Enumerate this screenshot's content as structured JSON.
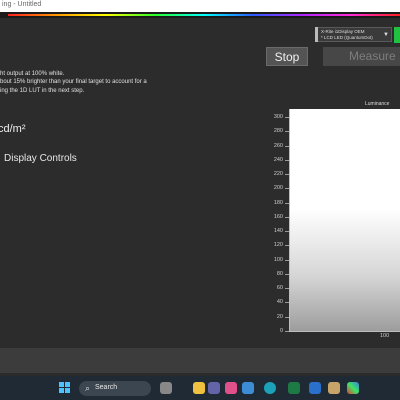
{
  "window": {
    "title": "ing - Untitled"
  },
  "device": {
    "line1": "X-Rite i1Display OEM",
    "line2": "* LCD LED (QuantumDot)"
  },
  "buttons": {
    "stop": "Stop",
    "measure": "Measure"
  },
  "instructions": [
    "ht output at 100% white.",
    "bout 15% brighter than your final target to account for a",
    "ing the 1D LUT in the next step."
  ],
  "luminance_unit_text": "cd/m²",
  "display_controls": "Display Controls",
  "taskbar": {
    "search": "Search"
  },
  "chart_data": {
    "type": "area",
    "title": "Luminance",
    "yticks": [
      0,
      20,
      40,
      60,
      80,
      100,
      120,
      140,
      160,
      180,
      200,
      220,
      240,
      260,
      280,
      300
    ],
    "xticks": [
      100
    ],
    "ylim": [
      0,
      300
    ],
    "fill_colors": {
      "top": "#ffffff",
      "bottom": "#9d9d9d"
    }
  },
  "colors": {
    "background": "#2c2c2c",
    "taskbar": "#1f2a35",
    "indicator": "#20c040"
  }
}
